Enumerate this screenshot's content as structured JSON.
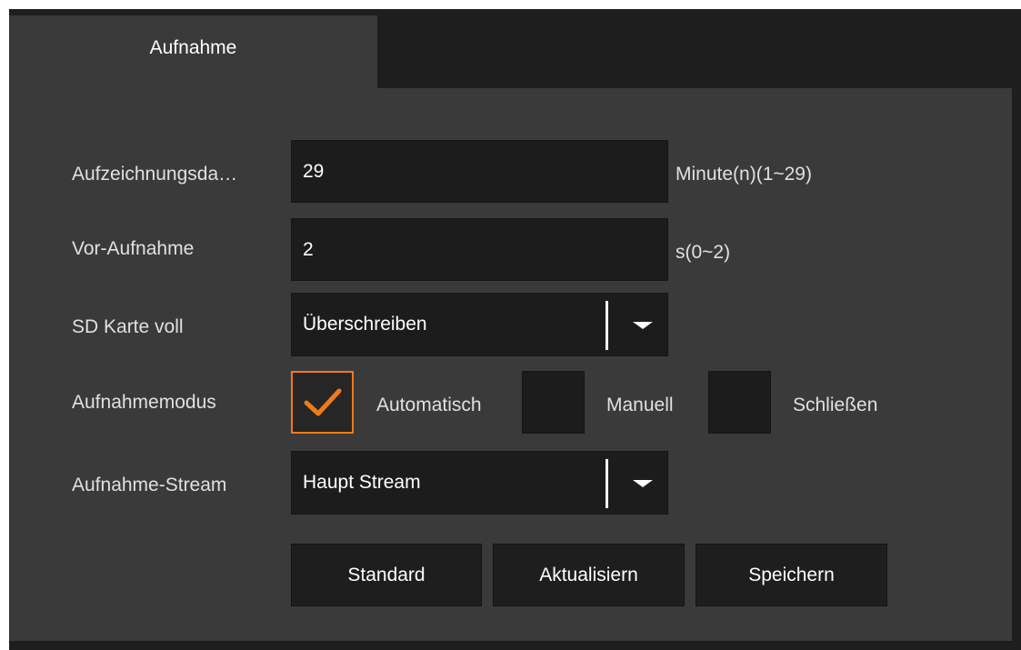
{
  "tab": {
    "label": "Aufnahme"
  },
  "fields": {
    "duration": {
      "label": "Aufzeichnungsda…",
      "value": "29",
      "unit": "Minute(n)(1~29)"
    },
    "prerecord": {
      "label": "Vor-Aufnahme",
      "value": "2",
      "unit": "s(0~2)"
    },
    "sd_full": {
      "label": "SD Karte voll",
      "value": "Überschreiben"
    },
    "mode": {
      "label": "Aufnahmemodus",
      "options": [
        {
          "label": "Automatisch",
          "checked": true
        },
        {
          "label": "Manuell",
          "checked": false
        },
        {
          "label": "Schließen",
          "checked": false
        }
      ]
    },
    "stream": {
      "label": "Aufnahme-Stream",
      "value": "Haupt Stream"
    }
  },
  "buttons": {
    "default": "Standard",
    "refresh": "Aktualisiern",
    "save": "Speichern"
  },
  "colors": {
    "accent": "#f07a1a",
    "panel": "#3a3a3a",
    "field": "#1c1c1c"
  },
  "icons": {
    "check": "checkmark-icon",
    "dropdown": "chevron-down-icon"
  }
}
